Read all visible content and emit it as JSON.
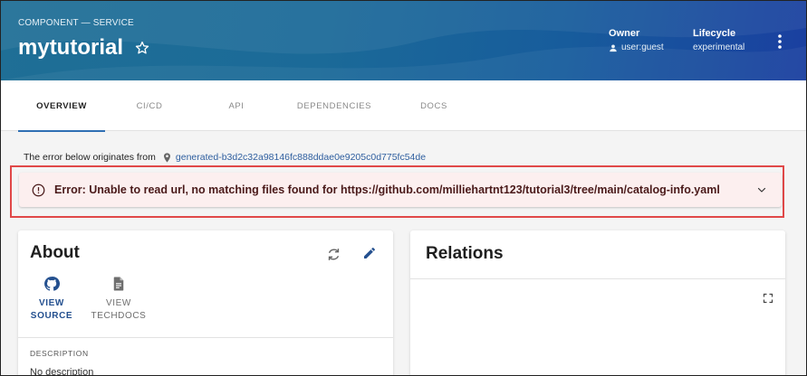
{
  "header": {
    "kicker": "COMPONENT — SERVICE",
    "title": "mytutorial",
    "owner_label": "Owner",
    "owner_value": "user:guest",
    "lifecycle_label": "Lifecycle",
    "lifecycle_value": "experimental",
    "icons": [
      "star-icon",
      "person-icon",
      "kebab-icon"
    ]
  },
  "tabs": [
    {
      "label": "OVERVIEW",
      "active": true
    },
    {
      "label": "CI/CD",
      "active": false
    },
    {
      "label": "API",
      "active": false
    },
    {
      "label": "DEPENDENCIES",
      "active": false
    },
    {
      "label": "DOCS",
      "active": false
    }
  ],
  "error": {
    "origin_text": "The error below originates from",
    "origin_link": "generated-b3d2c32a98146fc888ddae0e9205c0d775fc54de",
    "message": "Error: Unable to read url, no matching files found for https://github.com/milliehartnt123/tutorial3/tree/main/catalog-info.yaml"
  },
  "about": {
    "title": "About",
    "view_source_1": "VIEW",
    "view_source_2": "SOURCE",
    "view_techdocs_1": "VIEW",
    "view_techdocs_2": "TECHDOCS",
    "description_label": "DESCRIPTION",
    "description_value": "No description"
  },
  "relations": {
    "title": "Relations"
  },
  "colors": {
    "header_start": "#1f6f96",
    "header_end": "#1a3fa0",
    "link": "#2f5f9f",
    "error_bg": "#fcefef",
    "error_outline": "#e04848",
    "active_tab_indicator": "#2f6fb3"
  }
}
